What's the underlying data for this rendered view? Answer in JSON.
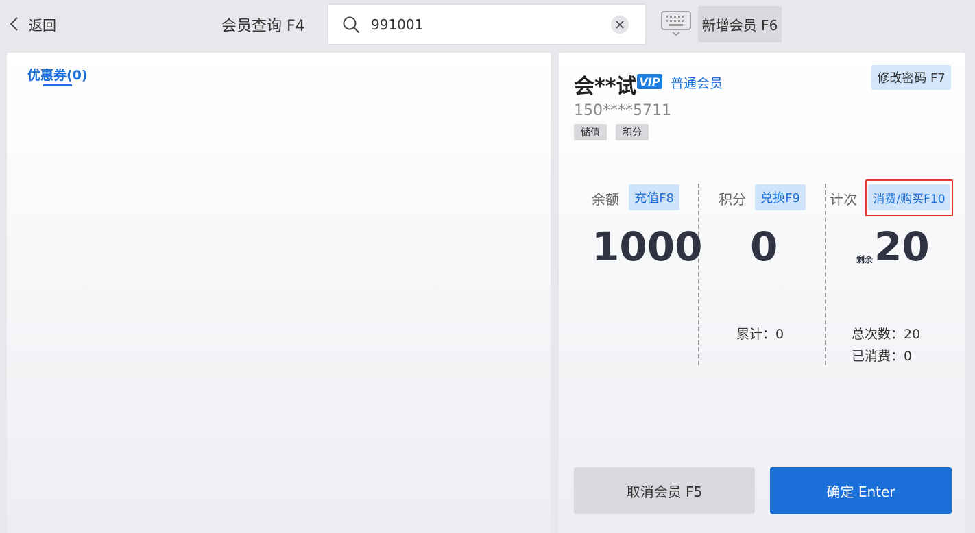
{
  "header": {
    "back_label": "返回",
    "query_title": "会员查询 F4",
    "search_value": "991001",
    "add_member_label": "新增会员 F6"
  },
  "left": {
    "coupon_tab": "优惠券(0)"
  },
  "member": {
    "name": "会**试",
    "vip_badge": "VIP",
    "level": "普通会员",
    "change_password_label": "修改密码 F7",
    "phone": "150****5711",
    "tags": [
      "储值",
      "积分"
    ]
  },
  "stats": {
    "balance": {
      "label": "余额",
      "button": "充值F8",
      "value": "1000"
    },
    "points": {
      "label": "积分",
      "button": "兑换F9",
      "value": "0",
      "total": "累计：0"
    },
    "count": {
      "label": "计次",
      "button": "消费/购买F10",
      "remain_label": "剩余",
      "value": "20",
      "total": "总次数：20",
      "used": "已消费：0"
    }
  },
  "actions": {
    "cancel_label": "取消会员 F5",
    "confirm_label": "确定 Enter"
  },
  "colors": {
    "accent": "#1a6fd8",
    "highlight": "#e53935"
  }
}
